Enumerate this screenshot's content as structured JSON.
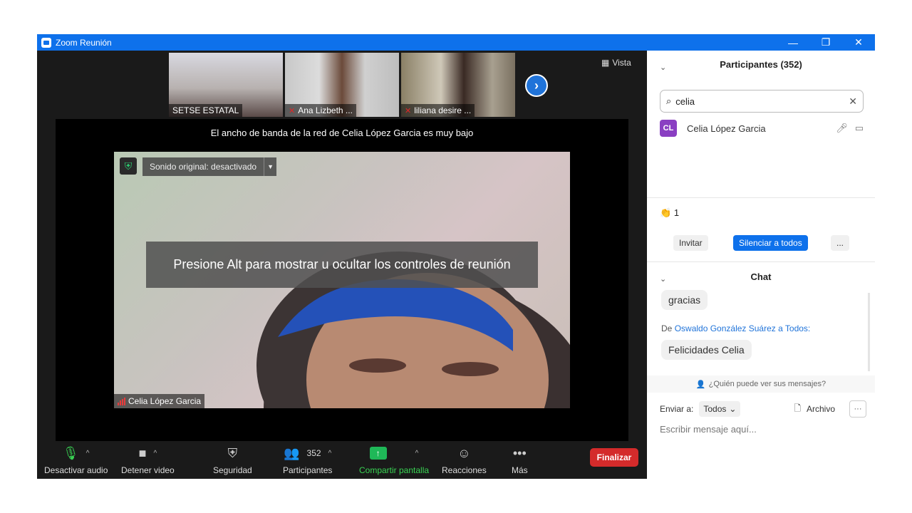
{
  "window": {
    "title": "Zoom Reunión",
    "minimize": "—",
    "restore": "❐",
    "close": "✕"
  },
  "thumbnails": [
    {
      "name": "SETSE ESTATAL",
      "muted": false
    },
    {
      "name": "Ana Lizbeth ...",
      "muted": true
    },
    {
      "name": "liliana desire ...",
      "muted": true
    }
  ],
  "view_button": "Vista",
  "bandwidth_message": "El ancho de banda de la red de Celia López Garcia es muy bajo",
  "original_sound": "Sonido original: desactivado",
  "alt_tip": "Presione Alt para mostrar u ocultar los controles de reunión",
  "active_speaker": "Celia López Garcia",
  "toolbar": {
    "mute": "Desactivar audio",
    "video": "Detener video",
    "security": "Seguridad",
    "participants": "Participantes",
    "participants_count": "352",
    "share": "Compartir pantalla",
    "reactions": "Reacciones",
    "more": "Más",
    "end": "Finalizar"
  },
  "participants_panel": {
    "title": "Participantes (352)",
    "search_value": "celia",
    "participant": {
      "initials": "CL",
      "name": "Celia López Garcia"
    },
    "clap_count": "1",
    "invite": "Invitar",
    "mute_all": "Silenciar a todos",
    "more": "..."
  },
  "chat": {
    "title": "Chat",
    "messages": [
      {
        "text": "gracias"
      },
      {
        "from_prefix": "De",
        "sender": "Oswaldo González Suárez",
        "to": "a Todos:",
        "text": "Felicidades Celia"
      }
    ],
    "who_can_see": "¿Quién puede ver sus mensajes?",
    "send_to_label": "Enviar a:",
    "send_to_value": "Todos",
    "file": "Archivo",
    "compose_placeholder": "Escribir mensaje aquí..."
  },
  "colors": {
    "titlebar": "#0e71eb",
    "end_button": "#d42b2b",
    "share_green": "#39d353",
    "avatar": "#8a3fc2"
  }
}
